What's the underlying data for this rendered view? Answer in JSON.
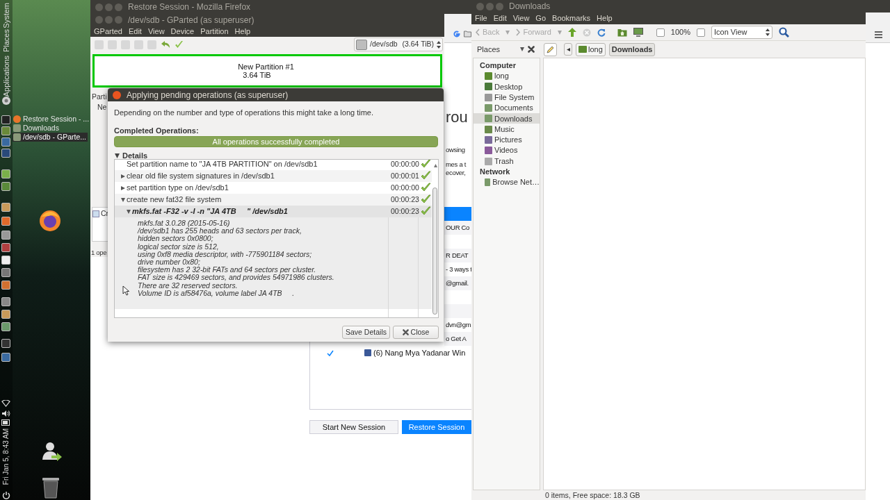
{
  "side_panel": {
    "menus": [
      {
        "label": "System"
      },
      {
        "label": "Places"
      },
      {
        "label": "Applications"
      }
    ],
    "clock": "Fri Jan 5, 8:43 AM"
  },
  "window_list": [
    {
      "label": "Restore Session - ...",
      "selected": false
    },
    {
      "label": "Downloads",
      "selected": false
    },
    {
      "label": "/dev/sdb - GParte...",
      "selected": true
    }
  ],
  "firefox": {
    "title": "Restore Session - Mozilla Firefox",
    "heading": "rou",
    "text_lines": [
      "owsing",
      "mes a t",
      "ecover,"
    ],
    "session_rows": [
      {
        "selected": true
      },
      {
        "text": "OUR Co",
        "selected": false
      },
      {
        "selected": false
      },
      {
        "text": "R DEAT",
        "selected": false
      },
      {
        "text": "- 3 ways t",
        "selected": false
      },
      {
        "text": "@gmail.",
        "selected": false
      },
      {
        "selected": false
      },
      {
        "selected": false
      },
      {
        "text": "dvn@gm",
        "selected": false
      },
      {
        "text": "o Get A",
        "selected": false
      },
      {
        "text": "(6) Nang Mya Yadanar Win",
        "selected": false,
        "checked": true
      }
    ],
    "buttons": [
      {
        "label": "Start New Session",
        "kind": "secondary"
      },
      {
        "label": "Restore Session",
        "kind": "primary"
      }
    ]
  },
  "gparted": {
    "title": "/dev/sdb - GParted (as superuser)",
    "menu": [
      "GParted",
      "Edit",
      "View",
      "Device",
      "Partition",
      "Help"
    ],
    "device": "/dev/sdb",
    "device_size": "(3.64 TiB)",
    "partition": {
      "name": "New Partition #1",
      "size": "3.64 TiB"
    },
    "list_header": "Parti",
    "list_row": "Ne",
    "operations_row": "Cr",
    "status_bar": "1 ope"
  },
  "dialog": {
    "title": "Applying pending operations (as superuser)",
    "message": "Depending on the number and type of operations this might take a long time.",
    "completed_label": "Completed Operations:",
    "progress": {
      "text": "All operations successfully completed",
      "level": 1
    },
    "details": {
      "label": "Details",
      "expanded": true
    },
    "operations": [
      {
        "text": "Set partition name to \"JA 4TB PARTITION\" on /dev/sdb1",
        "time": "00:00:00",
        "success": true
      },
      {
        "text": "clear old file system signatures in /dev/sdb1",
        "time": "00:00:01",
        "success": true,
        "expanded": false
      },
      {
        "text": "set partition type on /dev/sdb1",
        "time": "00:00:00",
        "success": true,
        "expanded": false
      },
      {
        "text": "create new fat32 file system",
        "time": "00:00:23",
        "success": true,
        "expanded": true,
        "children": [
          {
            "kind": "command",
            "text": "mkfs.fat -F32 -v -I -n \"JA 4TB     \" /dev/sdb1",
            "time": "00:00:23",
            "success": true,
            "expanded": true,
            "output": [
              "mkfs.fat 3.0.28 (2015-05-16)",
              "/dev/sdb1 has 255 heads and 63 sectors per track,",
              "hidden sectors 0x0800;",
              "logical sector size is 512,",
              "using 0xf8 media descriptor, with -775901184 sectors;",
              "drive number 0x80;",
              "filesystem has 2 32-bit FATs and 64 sectors per cluster.",
              "FAT size is 429469 sectors, and provides 54971986 clusters.",
              "There are 32 reserved sectors.",
              "Volume ID is af58476a, volume label JA 4TB     ."
            ]
          }
        ]
      }
    ],
    "buttons": [
      {
        "label": "Save Details",
        "kind": "plain"
      },
      {
        "label": "Close",
        "kind": "close"
      }
    ]
  },
  "files": {
    "title": "Downloads",
    "menu": [
      "File",
      "Edit",
      "View",
      "Go",
      "Bookmarks",
      "Help"
    ],
    "toolbar": {
      "back": {
        "label": "Back",
        "disabled": true
      },
      "forward": {
        "label": "Forward",
        "disabled": true
      },
      "zoom": "100%",
      "view": "Icon View"
    },
    "pane_label": "Places",
    "path": [
      {
        "label": "long",
        "selected": false
      },
      {
        "label": "Downloads",
        "selected": true
      }
    ],
    "sidebar": [
      {
        "heading": "Computer",
        "items": [
          {
            "label": "long",
            "selected": false
          },
          {
            "label": "Desktop",
            "selected": false
          },
          {
            "label": "File System",
            "selected": false
          },
          {
            "label": "Documents",
            "selected": false
          },
          {
            "label": "Downloads",
            "selected": true
          },
          {
            "label": "Music",
            "selected": false
          },
          {
            "label": "Pictures",
            "selected": false
          },
          {
            "label": "Videos",
            "selected": false
          },
          {
            "label": "Trash",
            "selected": false
          }
        ]
      },
      {
        "heading": "Network",
        "items": [
          {
            "label": "Browse Net…",
            "selected": false
          }
        ]
      }
    ],
    "status": "0 items, Free space: 18.3 GB"
  }
}
